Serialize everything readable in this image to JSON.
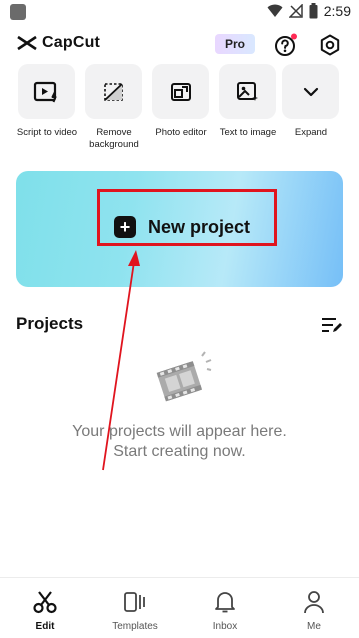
{
  "status_bar": {
    "time": "2:59"
  },
  "header": {
    "app_name": "CapCut",
    "pro_badge": "Pro"
  },
  "tools": [
    {
      "label": "Script to video",
      "icon": "script-to-video-icon"
    },
    {
      "label": "Remove background",
      "icon": "remove-background-icon"
    },
    {
      "label": "Photo editor",
      "icon": "photo-editor-icon"
    },
    {
      "label": "Text to image",
      "icon": "text-to-image-icon"
    },
    {
      "label": "Expand",
      "icon": "chevron-down-icon"
    }
  ],
  "banner": {
    "label": "New project"
  },
  "projects": {
    "title": "Projects",
    "empty_line1": "Your projects will appear here.",
    "empty_line2": "Start creating now."
  },
  "nav": [
    {
      "label": "Edit",
      "icon": "scissors-icon",
      "active": true
    },
    {
      "label": "Templates",
      "icon": "templates-icon",
      "active": false
    },
    {
      "label": "Inbox",
      "icon": "bell-icon",
      "active": false
    },
    {
      "label": "Me",
      "icon": "person-icon",
      "active": false
    }
  ],
  "colors": {
    "highlight": "#e0141e",
    "notification_dot": "#ff2a55"
  }
}
